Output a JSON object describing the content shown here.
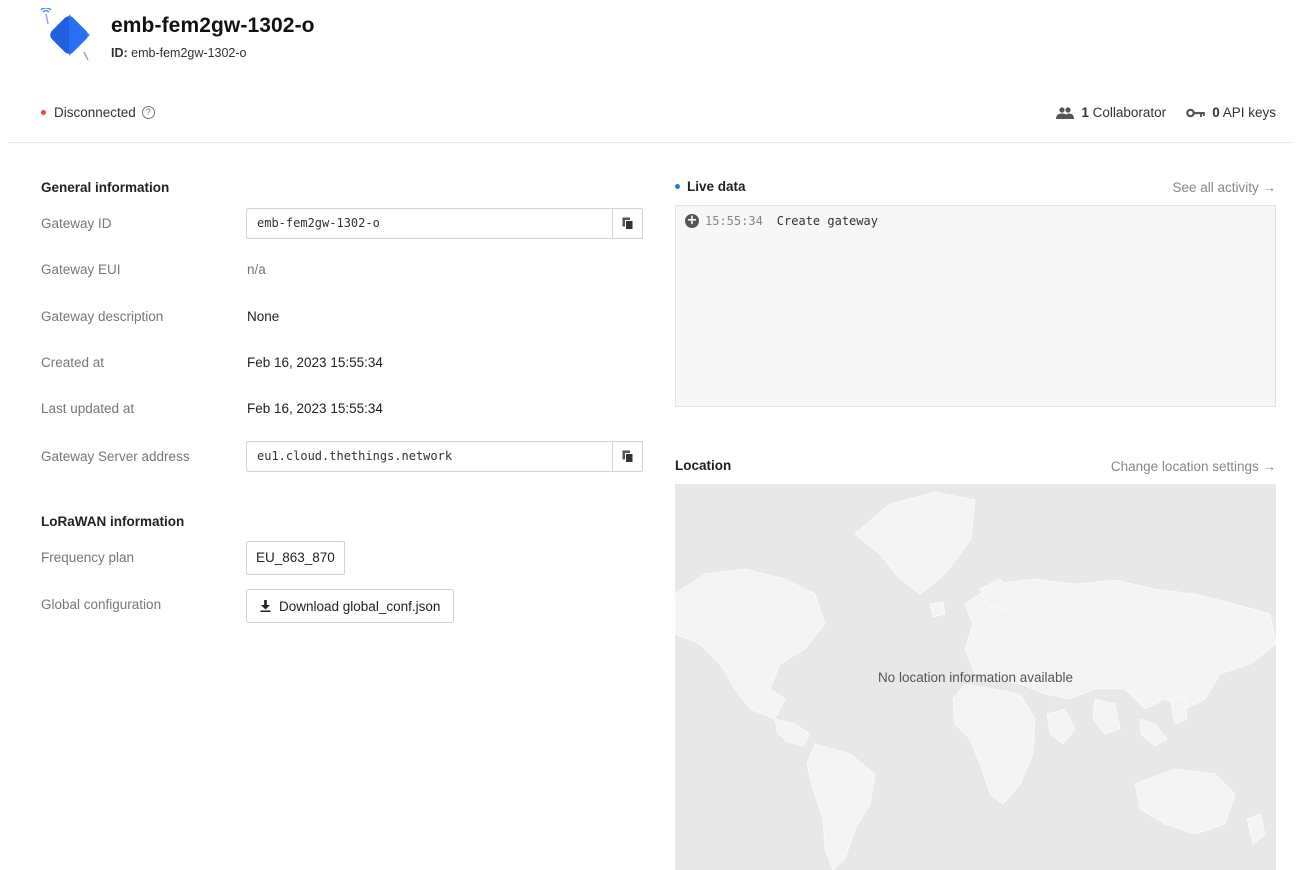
{
  "gateway": {
    "title": "emb-fem2gw-1302-o",
    "id_label": "ID:",
    "id_value": "emb-fem2gw-1302-o"
  },
  "status": {
    "text": "Disconnected",
    "help_icon": "question-circle-icon",
    "color": "#e8433e"
  },
  "meta": {
    "collaborators_count": "1",
    "collaborators_label": "Collaborator",
    "api_keys_count": "0",
    "api_keys_label": "API keys"
  },
  "general": {
    "section_title": "General information",
    "rows": {
      "gateway_id": {
        "label": "Gateway ID",
        "value": "emb-fem2gw-1302-o"
      },
      "gateway_eui": {
        "label": "Gateway EUI",
        "value": "n/a"
      },
      "gateway_description": {
        "label": "Gateway description",
        "value": "None"
      },
      "created_at": {
        "label": "Created at",
        "value": "Feb 16, 2023 15:55:34"
      },
      "last_updated_at": {
        "label": "Last updated at",
        "value": "Feb 16, 2023 15:55:34"
      },
      "server_address": {
        "label": "Gateway Server address",
        "value": "eu1.cloud.thethings.network"
      }
    }
  },
  "lorawan": {
    "section_title": "LoRaWAN information",
    "frequency_plan": {
      "label": "Frequency plan",
      "value": "EU_863_870"
    },
    "global_config": {
      "label": "Global configuration",
      "button": "Download global_conf.json"
    }
  },
  "live_data": {
    "title": "Live data",
    "link": "See all activity →",
    "events": [
      {
        "time": "15:55:34",
        "name": "Create gateway"
      }
    ]
  },
  "location": {
    "title": "Location",
    "link": "Change location settings →",
    "empty_message": "No location information available"
  },
  "colors": {
    "accent": "#2f6fe8",
    "disconnected": "#e8433e"
  }
}
